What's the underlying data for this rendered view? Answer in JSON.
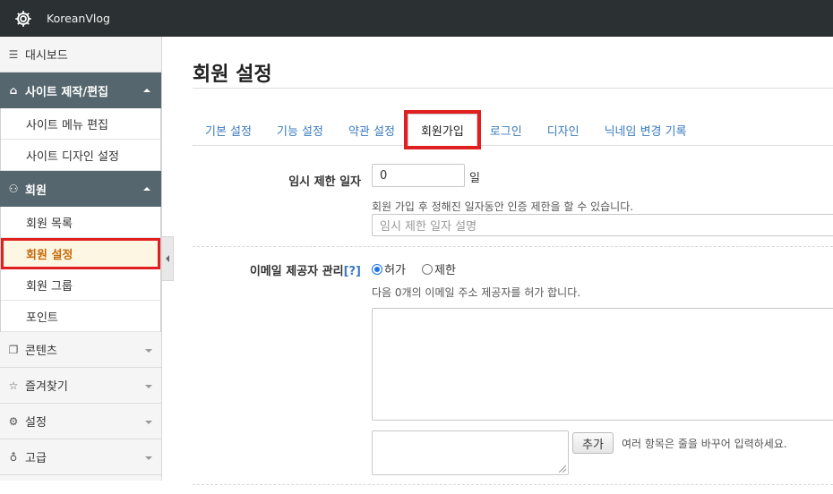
{
  "app": {
    "title": "KoreanVlog",
    "logo_icon": "gear-icon"
  },
  "sidebar": {
    "dashboard": {
      "label": "대시보드",
      "icon": "menu-lines-icon"
    },
    "sections": [
      {
        "label": "사이트 제작/편집",
        "icon": "home-icon",
        "expanded": true,
        "items": [
          {
            "label": "사이트 메뉴 편집"
          },
          {
            "label": "사이트 디자인 설정"
          }
        ]
      },
      {
        "label": "회원",
        "icon": "users-icon",
        "expanded": true,
        "items": [
          {
            "label": "회원 목록"
          },
          {
            "label": "회원 설정",
            "active": true
          },
          {
            "label": "회원 그룹"
          },
          {
            "label": "포인트"
          }
        ]
      }
    ],
    "collapsed": [
      {
        "label": "콘텐츠",
        "icon": "pages-icon"
      },
      {
        "label": "즐겨찾기",
        "icon": "star-icon"
      },
      {
        "label": "설정",
        "icon": "gear-icon"
      },
      {
        "label": "고급",
        "icon": "bulb-icon"
      }
    ]
  },
  "main": {
    "title": "회원 설정",
    "tabs": [
      {
        "label": "기본 설정"
      },
      {
        "label": "기능 설정"
      },
      {
        "label": "약관 설정"
      },
      {
        "label": "회원가입",
        "active": true
      },
      {
        "label": "로그인"
      },
      {
        "label": "디자인"
      },
      {
        "label": "닉네임 변경 기록"
      }
    ],
    "limit_days": {
      "label": "임시 제한 일자",
      "value": "0",
      "unit": "일",
      "help": "회원 가입 후 정해진 일자동안 인증 제한을 할 수 있습니다.",
      "desc_placeholder": "임시 제한 일자 설명"
    },
    "email_provider": {
      "label": "이메일 제공자 관리",
      "help_link": "[?]",
      "options": [
        {
          "label": "허가",
          "checked": true
        },
        {
          "label": "제한",
          "checked": false
        }
      ],
      "help": "다음 0개의 이메일 주소 제공자를 허가 합니다.",
      "add_button": "추가",
      "add_hint": "여러 항목은 줄을 바꾸어 입력하세요."
    }
  },
  "colors": {
    "topbar": "#2b3033",
    "section_header": "#55666e",
    "link": "#3a7bbf",
    "highlight": "#e02020",
    "active_text": "#c8690a"
  }
}
